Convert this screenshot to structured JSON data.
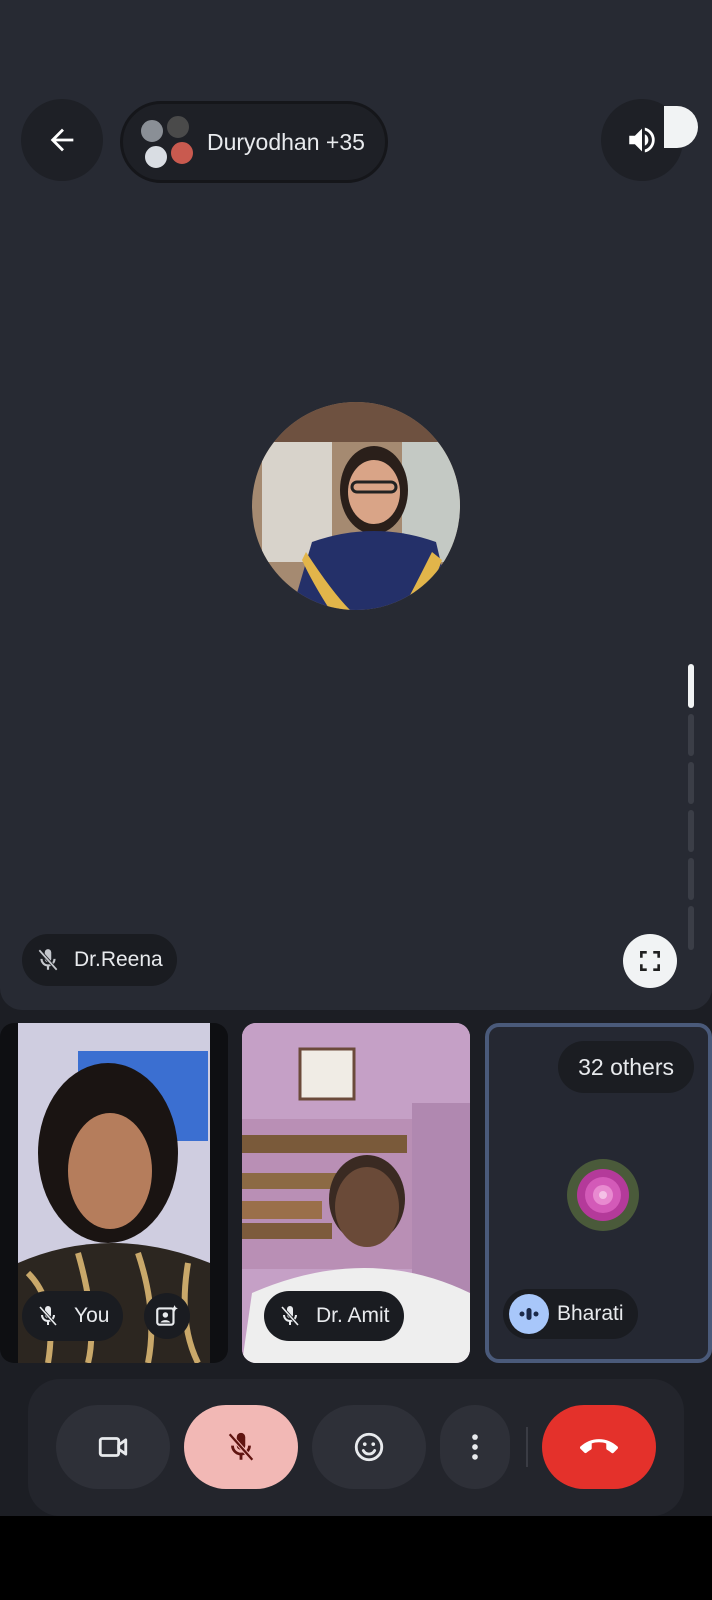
{
  "header": {
    "back_label": "",
    "participants_label": "Duryodhan +35"
  },
  "main_speaker": {
    "name": "Dr.Reena",
    "muted": true
  },
  "tiles": [
    {
      "name": "You",
      "muted": true
    },
    {
      "name": "Dr. Amit",
      "muted": true
    },
    {
      "name": "Bharati",
      "others_label": "32 others",
      "speaking": true
    }
  ],
  "controls": {
    "camera": "camera",
    "mic": "mic-muted",
    "reactions": "emoji",
    "more": "more-options",
    "end_call": "end-call"
  },
  "colors": {
    "background": "#1c1e24",
    "tile": "#272a33",
    "mic_muted_button": "#f2b8b5",
    "end_call": "#e4312b",
    "active_tile_border": "#4a5a7a"
  }
}
